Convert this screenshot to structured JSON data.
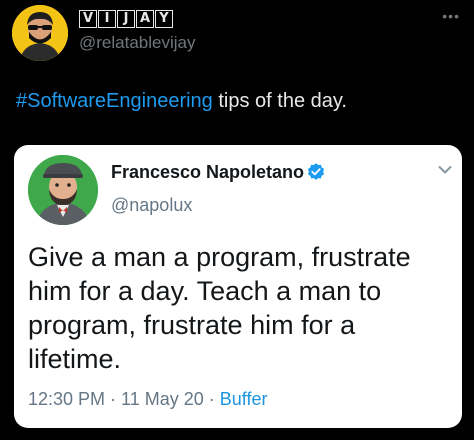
{
  "tweet": {
    "display_name_letters": [
      "V",
      "I",
      "J",
      "A",
      "Y"
    ],
    "handle": "@relatablevijay",
    "more_icon": "more-horizontal-icon",
    "text_hashtag": "#SoftwareEngineering",
    "text_rest": " tips of the day."
  },
  "quoted": {
    "author_name": "Francesco Napoletano",
    "verified_icon": "verified-badge-icon",
    "author_handle": "@napolux",
    "chevron_icon": "chevron-down-icon",
    "text": "Give a man a program, frustrate him for a day. Teach a man to program, frustrate him for a lifetime.",
    "time": "12:30 PM",
    "sep1": " · ",
    "date": "11 May 20",
    "sep2": " · ",
    "source": "Buffer"
  },
  "colors": {
    "background": "#000000",
    "link": "#1d9bf0",
    "avatar_bg": "#f3c316",
    "card_bg": "#ffffff"
  }
}
